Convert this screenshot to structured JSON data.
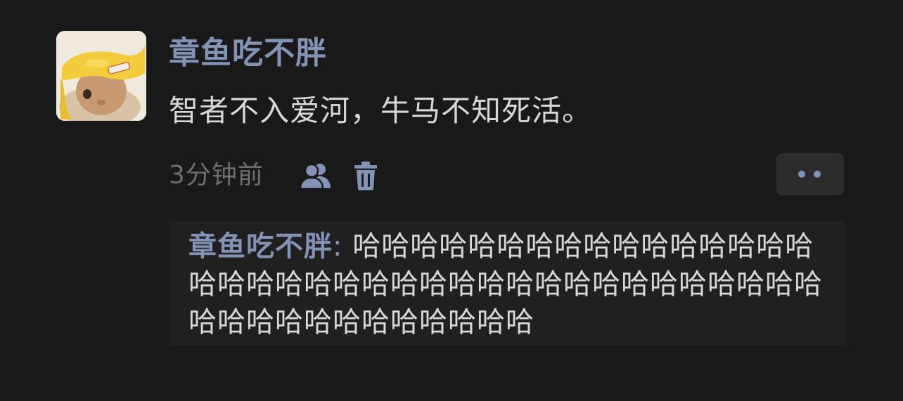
{
  "post": {
    "author": "章鱼吃不胖",
    "text": "智者不入爱河，牛马不知死活。",
    "timestamp": "3分钟前",
    "avatar_icon": "banana-hat-bunny-avatar",
    "visibility_icon": "people-icon",
    "delete_icon": "trash-icon",
    "more_icon": "more-dots-icon"
  },
  "comment": {
    "author": "章鱼吃不胖",
    "separator": ": ",
    "text": "哈哈哈哈哈哈哈哈哈哈哈哈哈哈哈哈哈哈哈哈哈哈哈哈哈哈哈哈哈哈哈哈哈哈哈哈哈哈哈哈哈哈哈哈哈哈哈哈哈哈"
  },
  "colors": {
    "background": "#191919",
    "accent": "#8293b4",
    "text": "#d7d7d7",
    "muted": "#6e6e6e",
    "comment_bg": "#202020",
    "button_bg": "#2c2c2c"
  }
}
